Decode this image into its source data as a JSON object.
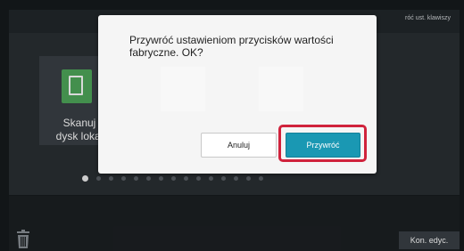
{
  "header": {
    "restore_keys_text": "róć ust. klawiszy"
  },
  "tile": {
    "label_line1": "Skanuj",
    "label_line2": "dysk lokal"
  },
  "pagination": {
    "count": 15,
    "active_index": 0
  },
  "footer": {
    "end_edit_label": "Kon. edyc."
  },
  "dialog": {
    "message": "Przywróć ustawieniom przycisków wartości fabryczne. OK?",
    "cancel_label": "Anuluj",
    "confirm_label": "Przywróć"
  },
  "colors": {
    "confirm_button": "#1a98b3",
    "highlight_border": "#d0233c",
    "tile_icon": "#4fa85b"
  },
  "icons": {
    "tile_icon": "document-copy-icon",
    "trash": "trash-icon"
  }
}
